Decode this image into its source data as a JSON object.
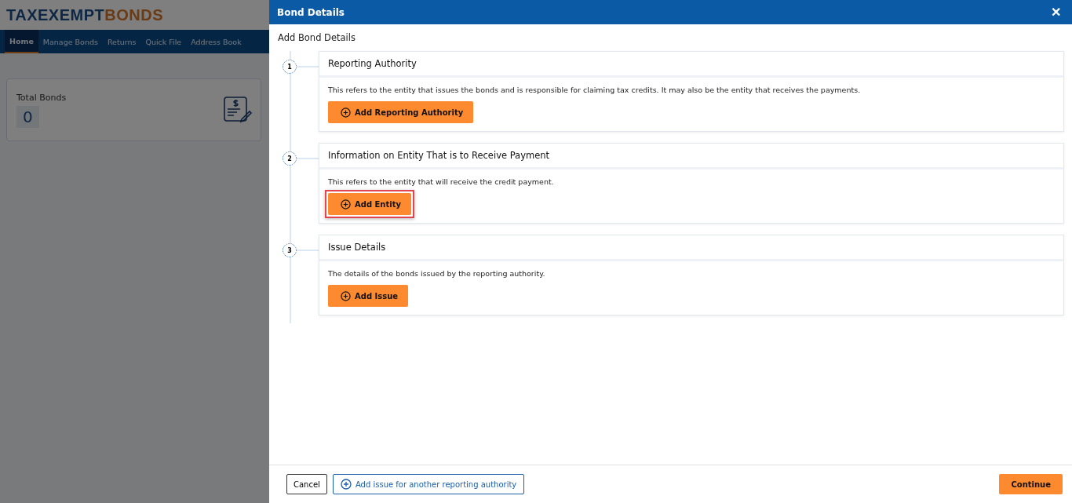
{
  "background_page": {
    "logo": {
      "part_1": "TAXEXEMPT",
      "part_2": "BONDS"
    },
    "nav": [
      {
        "label": "Home",
        "selected": true
      },
      {
        "label": "Manage Bonds",
        "selected": false
      },
      {
        "label": "Returns",
        "selected": false
      },
      {
        "label": "Quick File",
        "selected": false
      },
      {
        "label": "Address Book",
        "selected": false
      }
    ],
    "stat_card": {
      "label": "Total Bonds",
      "value": "0"
    }
  },
  "drawer": {
    "title": "Bond Details",
    "close": "✕",
    "subtitle": "Add Bond Details",
    "steps": [
      {
        "number": "1",
        "title": "Reporting Authority",
        "description": "This refers to the entity that issues the bonds and is responsible for claiming tax credits. It may also be the entity that receives the payments.",
        "button": "Add Reporting Authority",
        "highlighted": false
      },
      {
        "number": "2",
        "title": "Information on Entity That is to Receive Payment",
        "description": "This refers to the entity that will receive the credit payment.",
        "button": "Add Entity",
        "highlighted": true
      },
      {
        "number": "3",
        "title": "Issue Details",
        "description": "The details of the bonds issued by the reporting authority.",
        "button": "Add Issue",
        "highlighted": false
      }
    ],
    "footer": {
      "cancel": "Cancel",
      "add_another": "Add issue for another reporting authority",
      "continue": "Continue"
    }
  }
}
